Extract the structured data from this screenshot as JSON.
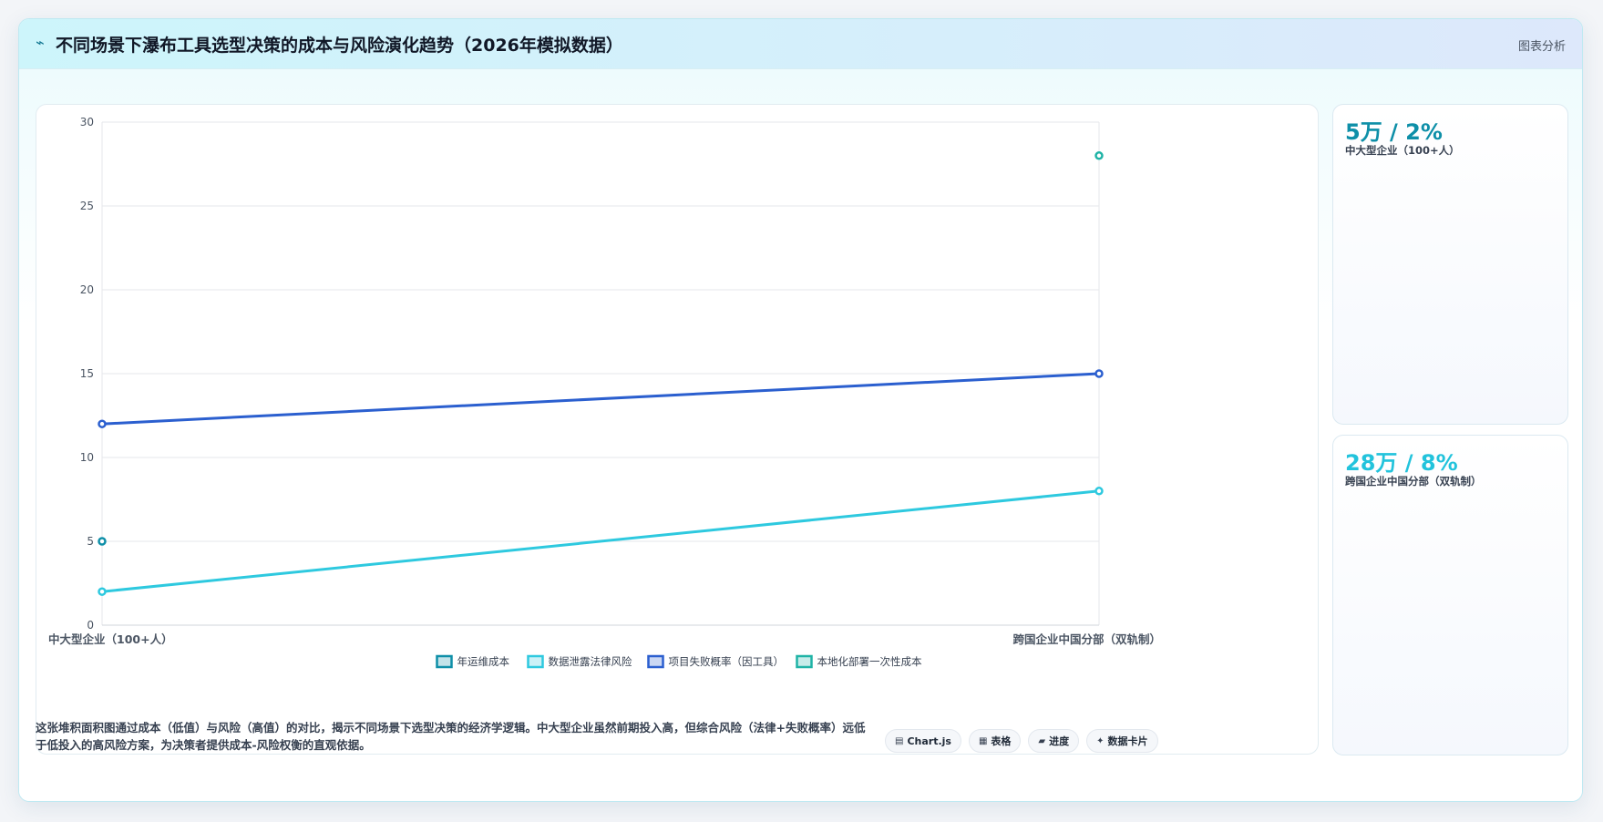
{
  "header": {
    "icon": "pulse-icon",
    "title": "不同场景下瀑布工具选型决策的成本与风险演化趋势（2026年模拟数据）",
    "link_label": "图表分析"
  },
  "stats": [
    {
      "value": "5万 / 2%",
      "label": "中大型企业（100+人）",
      "color": "#0e8fa8"
    },
    {
      "value": "28万 / 8%",
      "label": "跨国企业中国分部（双轨制）",
      "color": "#22c3dc"
    }
  ],
  "footer": {
    "description": "这张堆积面积图通过成本（低值）与风险（高值）的对比，揭示不同场景下选型决策的经济学逻辑。中大型企业虽然前期投入高，但综合风险（法律+失败概率）远低于低投入的高风险方案，为决策者提供成本-风险权衡的直观依据。",
    "chips": [
      {
        "icon": "chart-icon",
        "glyph": "▤",
        "label": "Chart.js"
      },
      {
        "icon": "table-icon",
        "glyph": "▦",
        "label": "表格"
      },
      {
        "icon": "progress-icon",
        "glyph": "▰",
        "label": "进度"
      },
      {
        "icon": "sparkle-icon",
        "glyph": "✦",
        "label": "数据卡片"
      }
    ]
  },
  "chart_data": {
    "type": "line",
    "categories": [
      "中大型企业（100+人）",
      "跨国企业中国分部（双轨制）"
    ],
    "ylim": [
      0,
      30
    ],
    "yticks": [
      0,
      5,
      10,
      15,
      20,
      25,
      30
    ],
    "grid": true,
    "legend_position": "bottom",
    "series": [
      {
        "name": "年运维成本",
        "values": [
          5,
          null
        ],
        "color": "#0e8fa8"
      },
      {
        "name": "数据泄露法律风险",
        "values": [
          2,
          8
        ],
        "color": "#2ec9df"
      },
      {
        "name": "项目失败概率（因工具）",
        "values": [
          12,
          15
        ],
        "color": "#2b5fcf"
      },
      {
        "name": "本地化部署一次性成本",
        "values": [
          null,
          28
        ],
        "color": "#1fb3a6"
      }
    ]
  }
}
